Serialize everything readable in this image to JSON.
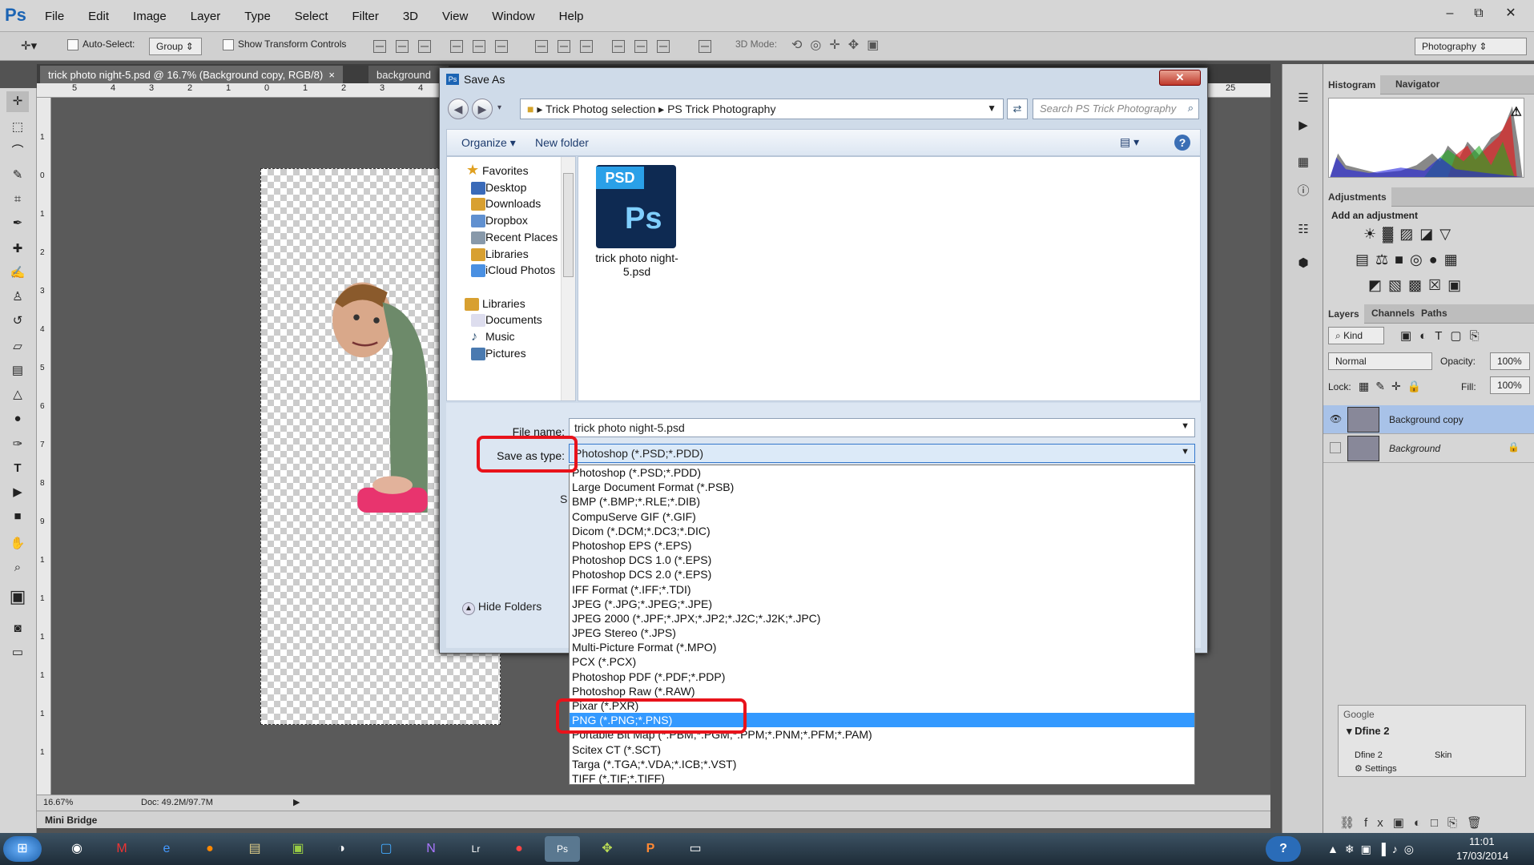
{
  "app": {
    "logo": "Ps",
    "menu": [
      "File",
      "Edit",
      "Image",
      "Layer",
      "Type",
      "Select",
      "Filter",
      "3D",
      "View",
      "Window",
      "Help"
    ],
    "window_controls": [
      "–",
      "⧉",
      "✕"
    ]
  },
  "options_bar": {
    "auto_select_label": "Auto-Select:",
    "auto_select_value": "Group",
    "transform_label": "Show Transform Controls",
    "mode_3d": "3D Mode:",
    "workspace": "Photography"
  },
  "document": {
    "tab_active": "trick photo night-5.psd @ 16.7% (Background copy, RGB/8)",
    "tab_close": "×",
    "tab_second": "background",
    "ruler_h": [
      "5",
      "4",
      "3",
      "2",
      "1",
      "0",
      "1",
      "2",
      "3",
      "4",
      "25"
    ],
    "ruler_v": [
      "1",
      "0",
      "1",
      "2",
      "3",
      "4",
      "5",
      "6",
      "7",
      "8",
      "9",
      "1",
      "1",
      "1",
      "1",
      "1",
      "1"
    ],
    "zoom": "16.67%",
    "doc_size": "Doc: 49.2M/97.7M",
    "mini_bridge": "Mini Bridge"
  },
  "panels": {
    "histogram_tab": "Histogram",
    "navigator_tab": "Navigator",
    "adjustments_tab": "Adjustments",
    "add_adjustment": "Add an adjustment",
    "layers_tab": "Layers",
    "channels_tab": "Channels",
    "paths_tab": "Paths",
    "kind": "Kind",
    "blend_mode": "Normal",
    "opacity_label": "Opacity:",
    "opacity": "100%",
    "lock_label": "Lock:",
    "fill_label": "Fill:",
    "fill": "100%",
    "layers": [
      {
        "name": "Background copy",
        "selected": true
      },
      {
        "name": "Background",
        "selected": false
      }
    ]
  },
  "google_panel": {
    "title": "Google",
    "item": "Dfine 2",
    "sub1": "Dfine 2",
    "sub2": "Skin",
    "settings": "Settings"
  },
  "dialog": {
    "title": "Save As",
    "close": "✕",
    "path_1": "Trick Photog selection",
    "path_2": "PS Trick Photography",
    "search_placeholder": "Search PS Trick Photography",
    "organize": "Organize",
    "new_folder": "New folder",
    "help": "?",
    "favorites_header": "Favorites",
    "favorites": [
      "Desktop",
      "Downloads",
      "Dropbox",
      "Recent Places",
      "Libraries",
      "iCloud Photos"
    ],
    "libraries_header": "Libraries",
    "libraries": [
      "Documents",
      "Music",
      "Pictures"
    ],
    "file_icon_label": "PSD",
    "file_icon_ps": "Ps",
    "file_name_display": "trick photo night-5.psd",
    "file_name_label": "File name:",
    "file_name_value": "trick photo night-5.psd",
    "save_type_label": "Save as type:",
    "save_type_value": "Photoshop (*.PSD;*.PDD)",
    "hide_folders": "Hide Folders",
    "s_letter": "S",
    "types": [
      "Photoshop (*.PSD;*.PDD)",
      "Large Document Format (*.PSB)",
      "BMP (*.BMP;*.RLE;*.DIB)",
      "CompuServe GIF (*.GIF)",
      "Dicom (*.DCM;*.DC3;*.DIC)",
      "Photoshop EPS (*.EPS)",
      "Photoshop DCS 1.0 (*.EPS)",
      "Photoshop DCS 2.0 (*.EPS)",
      "IFF Format (*.IFF;*.TDI)",
      "JPEG (*.JPG;*.JPEG;*.JPE)",
      "JPEG 2000 (*.JPF;*.JPX;*.JP2;*.J2C;*.J2K;*.JPC)",
      "JPEG Stereo (*.JPS)",
      "Multi-Picture Format (*.MPO)",
      "PCX (*.PCX)",
      "Photoshop PDF (*.PDF;*.PDP)",
      "Photoshop Raw (*.RAW)",
      "Pixar (*.PXR)",
      "PNG (*.PNG;*.PNS)",
      "Portable Bit Map (*.PBM;*.PGM;*.PPM;*.PNM;*.PFM;*.PAM)",
      "Scitex CT (*.SCT)",
      "Targa (*.TGA;*.VDA;*.ICB;*.VST)",
      "TIFF (*.TIF;*.TIFF)"
    ],
    "highlighted_type": "PNG (*.PNG;*.PNS)"
  },
  "taskbar": {
    "clock_time": "11:01",
    "clock_date": "17/03/2014",
    "apps": [
      "chrome",
      "gmail",
      "ie",
      "firefox",
      "explorer",
      "app5",
      "app6",
      "app7",
      "onenote",
      "lightroom",
      "app10",
      "photoshop",
      "app12",
      "powerpoint",
      "app14"
    ]
  }
}
